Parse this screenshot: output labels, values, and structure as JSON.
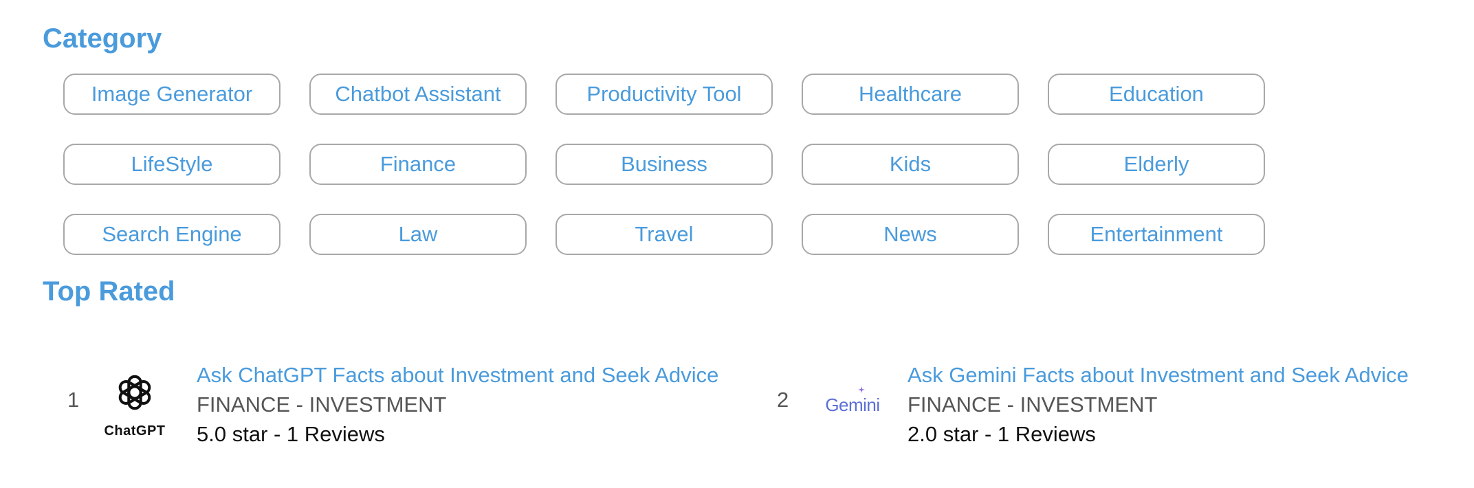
{
  "category": {
    "title": "Category",
    "chips": [
      "Image Generator",
      "Chatbot Assistant",
      "Productivity Tool",
      "Healthcare",
      "Education",
      "LifeStyle",
      "Finance",
      "Business",
      "Kids",
      "Elderly",
      "Search Engine",
      "Law",
      "Travel",
      "News",
      "Entertainment"
    ]
  },
  "top_rated": {
    "title": "Top Rated",
    "items": [
      {
        "rank": "1",
        "logo_text": "ChatGPT",
        "logo_icon": "chatgpt-logo",
        "title": "Ask ChatGPT Facts about Investment and Seek Advice",
        "category": "FINANCE - INVESTMENT",
        "rating": "5.0 star - 1 Reviews"
      },
      {
        "rank": "2",
        "logo_text": "Gemini",
        "logo_icon": "gemini-logo",
        "title": "Ask Gemini Facts about Investment and Seek Advice",
        "category": "FINANCE - INVESTMENT",
        "rating": "2.0 star - 1 Reviews"
      }
    ]
  },
  "colors": {
    "accent": "#4a9bdc",
    "chip_border": "#a8a8a8",
    "secondary_text": "#555555",
    "primary_text": "#111111"
  }
}
